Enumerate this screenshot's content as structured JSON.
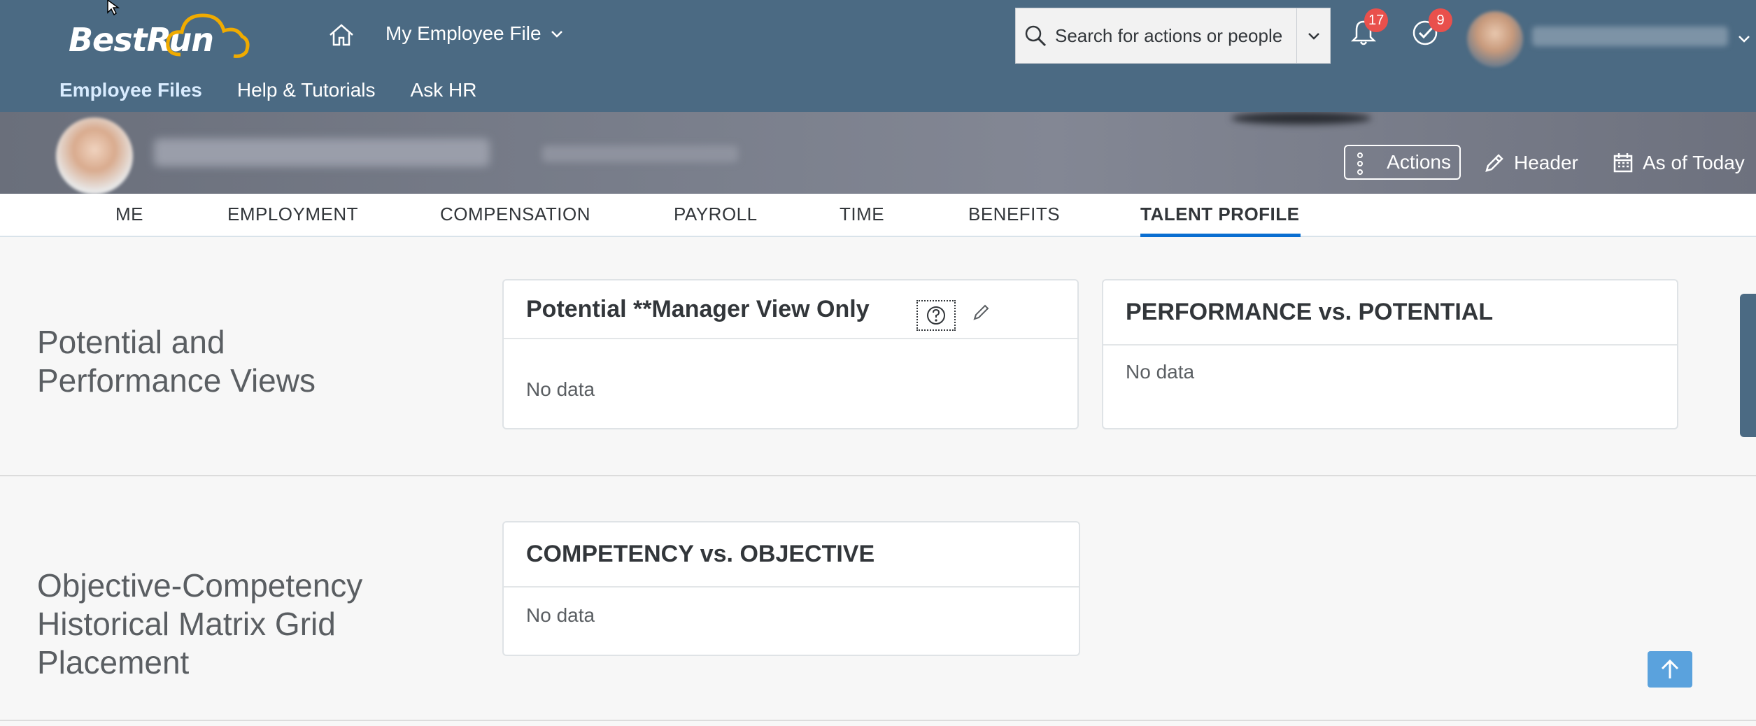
{
  "shell": {
    "logo_text": "BestRun",
    "app_title": "My Employee File",
    "search_placeholder": "Search for actions or people",
    "notifications_count": "17",
    "tasks_count": "9",
    "nav": [
      "Employee Files",
      "Help & Tutorials",
      "Ask HR"
    ]
  },
  "header": {
    "actions_label": "Actions",
    "header_label": "Header",
    "as_of_label": "As of Today"
  },
  "tabs": [
    "ME",
    "EMPLOYMENT",
    "COMPENSATION",
    "PAYROLL",
    "TIME",
    "BENEFITS",
    "TALENT PROFILE"
  ],
  "active_tab": "TALENT PROFILE",
  "sections": [
    {
      "title": "Potential and Performance Views",
      "cards": [
        {
          "title": "Potential **Manager View Only",
          "body": "No data"
        },
        {
          "title": "PERFORMANCE vs. POTENTIAL",
          "body": "No data"
        }
      ]
    },
    {
      "title": "Objective-Competency Historical Matrix Grid Placement",
      "cards": [
        {
          "title": "COMPETENCY vs. OBJECTIVE",
          "body": "No data"
        }
      ]
    }
  ],
  "colors": {
    "shell_bg": "#4b6a83",
    "accent": "#0a6ed1",
    "badge": "#e9504c",
    "back_to_top": "#5aa2dd"
  }
}
